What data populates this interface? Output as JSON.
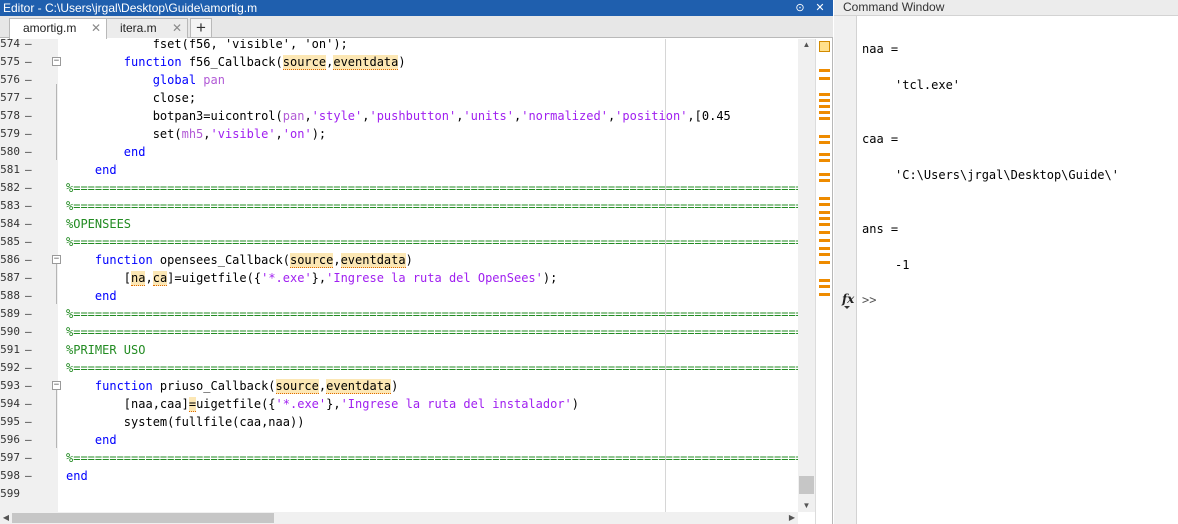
{
  "editor": {
    "title": "Editor - C:\\Users\\jrgal\\Desktop\\Guide\\amortig.m",
    "tabs": [
      {
        "label": "amortig.m",
        "active": true
      },
      {
        "label": "itera.m",
        "active": false
      }
    ],
    "new_tab_label": "+",
    "tab_close_glyph": "✕",
    "partial_line": "fset(f56, 'visible', 'on');",
    "lines": [
      {
        "n": "575",
        "segments": [
          [
            "        ",
            ""
          ],
          [
            "function",
            "kw"
          ],
          [
            " f56_Callback(",
            ""
          ],
          [
            "source",
            "hl"
          ],
          [
            ",",
            ""
          ],
          [
            "eventdata",
            "hl"
          ],
          [
            ")",
            ""
          ]
        ],
        "fold": true
      },
      {
        "n": "576",
        "segments": [
          [
            "            ",
            ""
          ],
          [
            "global",
            "kw"
          ],
          [
            " ",
            ""
          ],
          [
            "pan",
            "var"
          ]
        ]
      },
      {
        "n": "577",
        "segments": [
          [
            "            close;",
            ""
          ]
        ]
      },
      {
        "n": "578",
        "segments": [
          [
            "            botpan3=uicontrol(",
            ""
          ],
          [
            "pan",
            "var"
          ],
          [
            ",",
            ""
          ],
          [
            "'style'",
            "str"
          ],
          [
            ",",
            ""
          ],
          [
            "'pushbutton'",
            "str"
          ],
          [
            ",",
            ""
          ],
          [
            "'units'",
            "str"
          ],
          [
            ",",
            ""
          ],
          [
            "'normalized'",
            "str"
          ],
          [
            ",",
            ""
          ],
          [
            "'position'",
            "str"
          ],
          [
            ",[0.45",
            ""
          ]
        ]
      },
      {
        "n": "579",
        "segments": [
          [
            "            set(",
            ""
          ],
          [
            "mh5",
            "var"
          ],
          [
            ",",
            ""
          ],
          [
            "'visible'",
            "str"
          ],
          [
            ",",
            ""
          ],
          [
            "'on'",
            "str"
          ],
          [
            ");",
            ""
          ]
        ]
      },
      {
        "n": "580",
        "segments": [
          [
            "        ",
            ""
          ],
          [
            "end",
            "kw"
          ]
        ]
      },
      {
        "n": "581",
        "segments": [
          [
            "    ",
            ""
          ],
          [
            "end",
            "kw"
          ]
        ]
      },
      {
        "n": "582",
        "segments": [
          [
            "%=======================================================================================================",
            "cmt"
          ]
        ]
      },
      {
        "n": "583",
        "segments": [
          [
            "%=======================================================================================================",
            "cmt"
          ]
        ]
      },
      {
        "n": "584",
        "segments": [
          [
            "%OPENSEES",
            "cmt"
          ]
        ]
      },
      {
        "n": "585",
        "segments": [
          [
            "%=======================================================================================================",
            "cmt"
          ]
        ]
      },
      {
        "n": "586",
        "segments": [
          [
            "    ",
            ""
          ],
          [
            "function",
            "kw"
          ],
          [
            " opensees_Callback(",
            ""
          ],
          [
            "source",
            "hl"
          ],
          [
            ",",
            ""
          ],
          [
            "eventdata",
            "hl"
          ],
          [
            ")",
            ""
          ]
        ],
        "fold": true
      },
      {
        "n": "587",
        "segments": [
          [
            "        [",
            ""
          ],
          [
            "na",
            "hl"
          ],
          [
            ",",
            ""
          ],
          [
            "ca",
            "hl"
          ],
          [
            "]=uigetfile({",
            ""
          ],
          [
            "'*.exe'",
            "str"
          ],
          [
            "},",
            ""
          ],
          [
            "'Ingrese la ruta del OpenSees'",
            "str"
          ],
          [
            ");",
            ""
          ]
        ]
      },
      {
        "n": "588",
        "segments": [
          [
            "    ",
            ""
          ],
          [
            "end",
            "kw"
          ]
        ]
      },
      {
        "n": "589",
        "segments": [
          [
            "%=======================================================================================================",
            "cmt"
          ]
        ]
      },
      {
        "n": "590",
        "segments": [
          [
            "%=======================================================================================================",
            "cmt"
          ]
        ]
      },
      {
        "n": "591",
        "segments": [
          [
            "%PRIMER USO",
            "cmt"
          ]
        ]
      },
      {
        "n": "592",
        "segments": [
          [
            "%=======================================================================================================",
            "cmt"
          ]
        ]
      },
      {
        "n": "593",
        "segments": [
          [
            "    ",
            ""
          ],
          [
            "function",
            "kw"
          ],
          [
            " priuso_Callback(",
            ""
          ],
          [
            "source",
            "hl"
          ],
          [
            ",",
            ""
          ],
          [
            "eventdata",
            "hl"
          ],
          [
            ")",
            ""
          ]
        ],
        "fold": true
      },
      {
        "n": "594",
        "segments": [
          [
            "        [naa,caa]",
            ""
          ],
          [
            "=",
            "hl"
          ],
          [
            "uigetfile({",
            ""
          ],
          [
            "'*.exe'",
            "str"
          ],
          [
            "},",
            ""
          ],
          [
            "'Ingrese la ruta del instalador'",
            "str"
          ],
          [
            ")",
            ""
          ]
        ]
      },
      {
        "n": "595",
        "segments": [
          [
            "        system(fullfile(caa,naa))",
            ""
          ]
        ]
      },
      {
        "n": "596",
        "segments": [
          [
            "    ",
            ""
          ],
          [
            "end",
            "kw"
          ]
        ]
      },
      {
        "n": "597",
        "segments": [
          [
            "%=======================================================================================================",
            "cmt"
          ]
        ]
      },
      {
        "n": "598",
        "segments": [
          [
            "",
            ""
          ],
          [
            "end",
            "kw"
          ]
        ]
      }
    ],
    "first_partial_line_number": "574",
    "end_line_number": "599"
  },
  "command_window": {
    "title": "Command Window",
    "output": [
      {
        "text": "naa =",
        "row": 0,
        "indent": 0
      },
      {
        "text": "'tcl.exe'",
        "row": 2,
        "indent": 1
      },
      {
        "text": "caa =",
        "row": 5,
        "indent": 0
      },
      {
        "text": "'C:\\Users\\jrgal\\Desktop\\Guide\\'",
        "row": 7,
        "indent": 1
      },
      {
        "text": "ans =",
        "row": 10,
        "indent": 0
      },
      {
        "text": "-1",
        "row": 12,
        "indent": 1
      }
    ],
    "fx_label": "fx",
    "prompt": ">>"
  },
  "colors": {
    "keyword": "#0000ff",
    "string": "#a020f0",
    "comment": "#228b22",
    "highlight": "#fce7b4",
    "analyzer_marker": "#ee8b00",
    "title_bar": "#1f5fae"
  }
}
